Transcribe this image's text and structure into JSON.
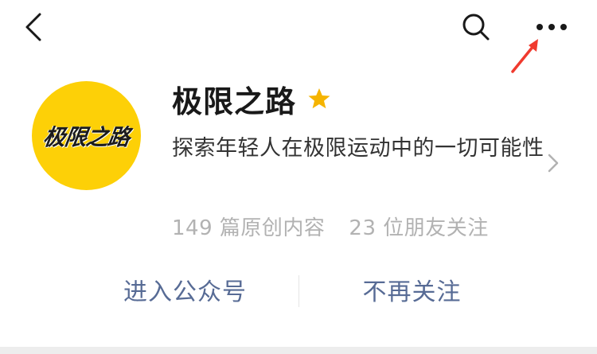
{
  "toolbar": {
    "back_icon": "chevron-left-icon",
    "search_icon": "search-icon",
    "more_icon": "more-horizontal-icon"
  },
  "annotation": {
    "arrow_color": "#F03A2E"
  },
  "account": {
    "name": "极限之路",
    "avatar_text": "极限之路",
    "avatar_bg": "#FDD007",
    "star_color": "#F5B400",
    "description": "探索年轻人在极限运动中的一切可能性",
    "stats": {
      "original_articles": "149 篇原创内容",
      "friends_following": "23 位朋友关注"
    }
  },
  "actions": {
    "enter_label": "进入公众号",
    "unfollow_label": "不再关注",
    "link_color": "#576B95"
  }
}
